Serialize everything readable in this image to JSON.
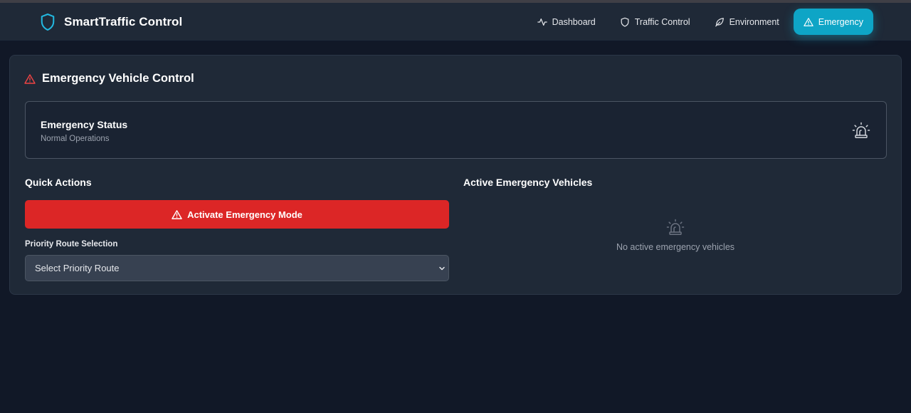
{
  "app": {
    "brand_name": "SmartTraffic Control",
    "brand_icon": "shield-icon",
    "accent_color": "#0ea5c6"
  },
  "nav": {
    "items": [
      {
        "label": "Dashboard",
        "icon": "activity-icon",
        "active": false
      },
      {
        "label": "Traffic Control",
        "icon": "shield-icon",
        "active": false
      },
      {
        "label": "Environment",
        "icon": "leaf-icon",
        "active": false
      },
      {
        "label": "Emergency",
        "icon": "alert-triangle-icon",
        "active": true
      }
    ]
  },
  "panel": {
    "title": "Emergency Vehicle Control",
    "title_icon": "alert-triangle-icon",
    "title_icon_color": "#ef4444"
  },
  "status": {
    "title": "Emergency Status",
    "value": "Normal Operations",
    "icon": "siren-icon"
  },
  "quick_actions": {
    "heading": "Quick Actions",
    "activate_button": "Activate Emergency Mode",
    "activate_color": "#dc2626",
    "route_label": "Priority Route Selection",
    "route_selected": "Select Priority Route"
  },
  "vehicles": {
    "heading": "Active Emergency Vehicles",
    "empty_text": "No active emergency vehicles",
    "empty_icon": "siren-icon"
  }
}
